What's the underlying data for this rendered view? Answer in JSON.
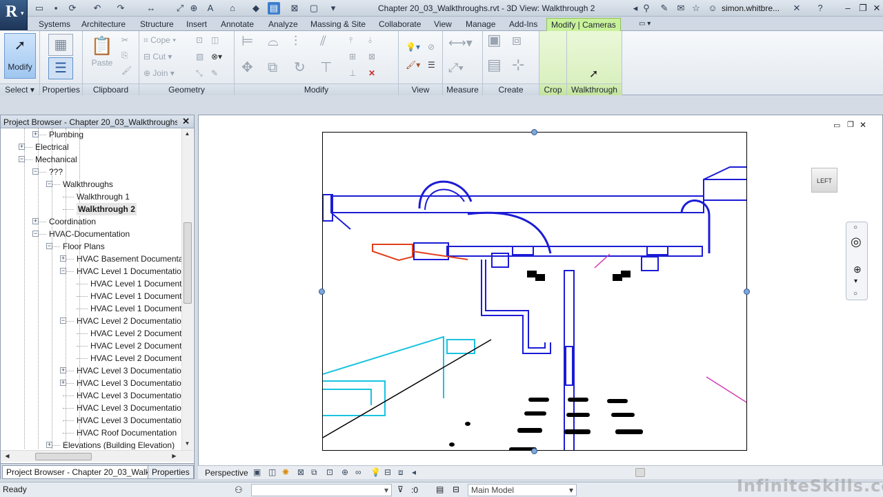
{
  "window": {
    "title": "Chapter 20_03_Walkthroughs.rvt - 3D View: Walkthrough 2",
    "user": "simon.whitbre...",
    "app_logo": "R"
  },
  "ribbon_tabs": [
    "Systems",
    "Architecture",
    "Structure",
    "Insert",
    "Annotate",
    "Analyze",
    "Massing & Site",
    "Collaborate",
    "View",
    "Manage",
    "Add-Ins",
    "Modify | Cameras"
  ],
  "ribbon": {
    "modify_label": "Modify",
    "select_label": "Select",
    "properties_label": "Properties",
    "clipboard_label": "Clipboard",
    "paste_label": "Paste",
    "geometry_label": "Geometry",
    "cope_label": "Cope",
    "cut_label": "Cut",
    "join_label": "Join",
    "modify_panel_label": "Modify",
    "view_label": "View",
    "measure_label": "Measure",
    "create_label": "Create",
    "crop_label": "Crop",
    "walkthrough_label": "Walkthrough"
  },
  "project_browser": {
    "title": "Project Browser - Chapter 20_03_Walkthroughs....",
    "items": [
      {
        "label": "Plumbing",
        "level": 2,
        "expander": "+"
      },
      {
        "label": "Electrical",
        "level": 1,
        "expander": "+"
      },
      {
        "label": "Mechanical",
        "level": 1,
        "expander": "-"
      },
      {
        "label": "???",
        "level": 2,
        "expander": "-"
      },
      {
        "label": "Walkthroughs",
        "level": 3,
        "expander": "-"
      },
      {
        "label": "Walkthrough 1",
        "level": 4,
        "expander": ""
      },
      {
        "label": "Walkthrough 2",
        "level": 4,
        "expander": "",
        "selected": true
      },
      {
        "label": "Coordination",
        "level": 2,
        "expander": "+"
      },
      {
        "label": "HVAC-Documentation",
        "level": 2,
        "expander": "-"
      },
      {
        "label": "Floor Plans",
        "level": 3,
        "expander": "-"
      },
      {
        "label": "HVAC Basement Documenta",
        "level": 4,
        "expander": "+"
      },
      {
        "label": "HVAC Level 1 Documentatio",
        "level": 4,
        "expander": "-"
      },
      {
        "label": "HVAC Level 1 Document",
        "level": 5,
        "expander": ""
      },
      {
        "label": "HVAC Level 1 Document",
        "level": 5,
        "expander": ""
      },
      {
        "label": "HVAC Level 1 Document",
        "level": 5,
        "expander": ""
      },
      {
        "label": "HVAC Level 2 Documentatio",
        "level": 4,
        "expander": "-"
      },
      {
        "label": "HVAC Level 2 Document",
        "level": 5,
        "expander": ""
      },
      {
        "label": "HVAC Level 2 Document",
        "level": 5,
        "expander": ""
      },
      {
        "label": "HVAC Level 2 Document",
        "level": 5,
        "expander": ""
      },
      {
        "label": "HVAC Level 3 Documentatio",
        "level": 4,
        "expander": "+"
      },
      {
        "label": "HVAC Level 3 Documentatio",
        "level": 4,
        "expander": "+"
      },
      {
        "label": "HVAC Level 3 Documentatio",
        "level": 4,
        "expander": ""
      },
      {
        "label": "HVAC Level 3 Documentatio",
        "level": 4,
        "expander": ""
      },
      {
        "label": "HVAC Level 3 Documentatio",
        "level": 4,
        "expander": ""
      },
      {
        "label": "HVAC Roof Documentation",
        "level": 4,
        "expander": ""
      },
      {
        "label": "Elevations (Building Elevation)",
        "level": 3,
        "expander": "+"
      }
    ],
    "tabs": [
      "Project Browser - Chapter 20_03_Walk...",
      "Properties"
    ]
  },
  "viewcube": {
    "face": "LEFT"
  },
  "view_control": {
    "mode": "Perspective"
  },
  "status": {
    "text": "Ready",
    "selection_count": ":0",
    "model": "Main Model"
  },
  "watermark": "InfiniteSkills.com",
  "colors": {
    "ductwork": "#1b1bd6",
    "cyan_elements": "#19c3e0",
    "red_element": "#e0401c",
    "magenta_line": "#d23ab8",
    "contextual_tab": "#c9f19b"
  }
}
